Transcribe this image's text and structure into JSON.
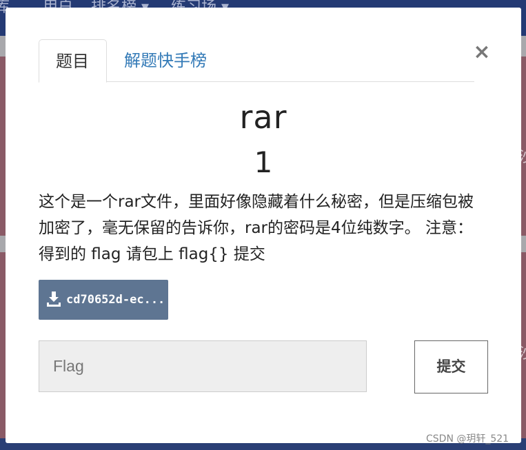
{
  "background": {
    "nav_items": [
      "库",
      "用户",
      "排名榜 ▾",
      "练习场 ▾"
    ],
    "side_text": [
      "沙",
      "沙"
    ]
  },
  "modal": {
    "tabs": [
      {
        "label": "题目",
        "active": true
      },
      {
        "label": "解题快手榜",
        "active": false
      }
    ],
    "close_glyph": "×",
    "challenge": {
      "name": "rar",
      "score": "1",
      "description": "这个是一个rar文件，里面好像隐藏着什么秘密，但是压缩包被加密了，毫无保留的告诉你，rar的密码是4位纯数字。 注意：得到的 flag 请包上 flag{} 提交"
    },
    "download": {
      "icon": "download-icon",
      "label": "cd70652d-ec..."
    },
    "flag_input": {
      "placeholder": "Flag",
      "value": ""
    },
    "submit_label": "提交"
  },
  "watermark": "CSDN @玥轩_521",
  "colors": {
    "download_bg": "#5e7592",
    "link": "#337ab7",
    "nav_bg": "#243a74"
  }
}
